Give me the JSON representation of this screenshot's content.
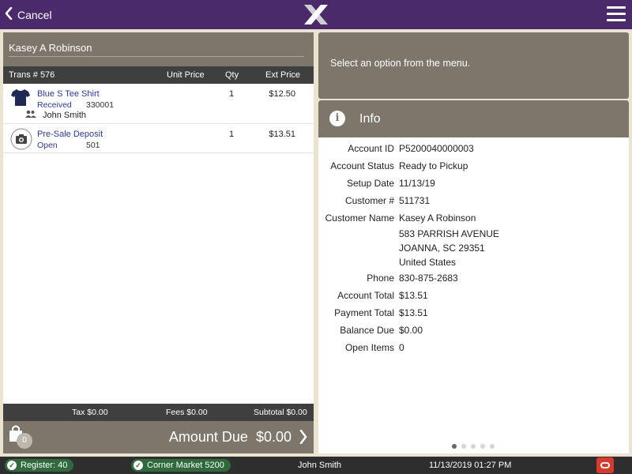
{
  "header": {
    "cancel_label": "Cancel",
    "logo_icon": "x-logo-icon",
    "menu_icon": "hamburger-menu-icon"
  },
  "customer": {
    "name": "Kasey A Robinson"
  },
  "transaction": {
    "trans_label": "Trans # 576",
    "columns": {
      "unit_price": "Unit Price",
      "qty": "Qty",
      "ext_price": "Ext Price"
    },
    "items": [
      {
        "name": "Blue S Tee Shirt",
        "status": "Received",
        "code": "330001",
        "qty": "1",
        "ext_price": "$12.50",
        "associate": "John Smith",
        "icon": "tshirt-icon"
      },
      {
        "name": "Pre-Sale Deposit",
        "status": "Open",
        "code": "501",
        "qty": "1",
        "ext_price": "$13.51",
        "icon": "camera-icon"
      }
    ],
    "totals": {
      "tax": "Tax $0.00",
      "fees": "Fees $0.00",
      "subtotal": "Subtotal $0.00"
    },
    "bag_count": "0",
    "amount_due": "Amount Due  $0.00"
  },
  "message_panel": {
    "text": "Select an option from the menu."
  },
  "info": {
    "title": "Info",
    "rows": [
      {
        "label": "Account ID",
        "value": "P5200040000003"
      },
      {
        "label": "Account Status",
        "value": "Ready to Pickup"
      },
      {
        "label": "Setup Date",
        "value": "11/13/19"
      },
      {
        "label": "Customer #",
        "value": "511731"
      },
      {
        "label": "Customer Name",
        "value": "Kasey A Robinson"
      }
    ],
    "address": [
      "583 PARRISH AVENUE",
      "JOANNA, SC 29351",
      "United States"
    ],
    "rows2": [
      {
        "label": "Phone",
        "value": "830-875-2683"
      },
      {
        "label": "Account Total",
        "value": "$13.51"
      },
      {
        "label": "Payment Total",
        "value": "$13.51"
      },
      {
        "label": "Balance Due",
        "value": "$0.00"
      },
      {
        "label": "Open Items",
        "value": "0"
      }
    ]
  },
  "status_bar": {
    "register": "Register: 40",
    "store": "Corner Market 5200",
    "user": "John Smith",
    "datetime": "11/13/2019 01:27 PM"
  },
  "colors": {
    "top_bar": "#4a2a6b",
    "panel_header": "#7d766b",
    "dark_bar": "#3f3f3f",
    "status_pill": "#2f6a3c",
    "alert": "#d93a2b"
  }
}
